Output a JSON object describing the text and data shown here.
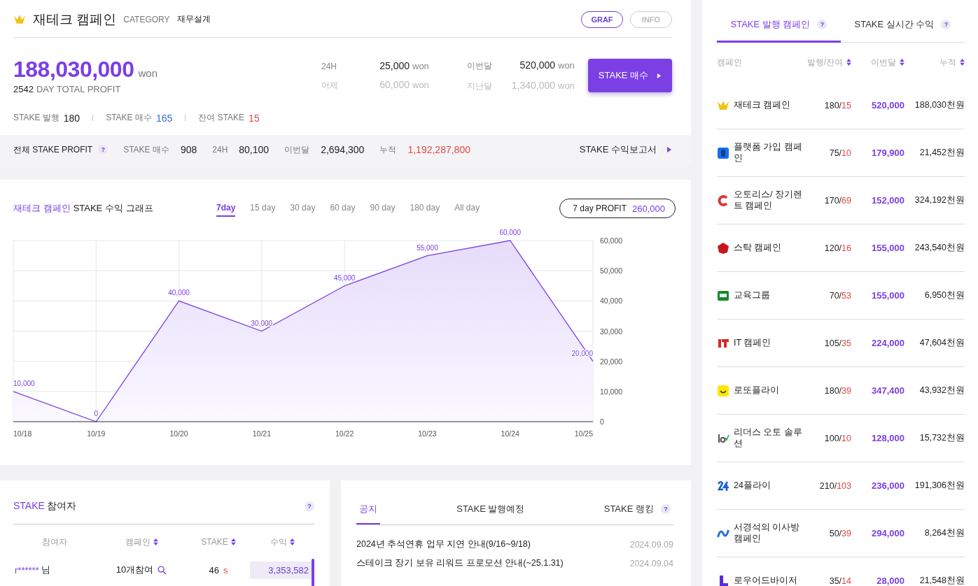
{
  "header": {
    "title": "재테크 캠페인",
    "category_label": "CATEGORY",
    "category": "재무설계",
    "buttons": [
      {
        "label": "GRAF",
        "selected": true
      },
      {
        "label": "INFO",
        "selected": false
      }
    ]
  },
  "total": {
    "amount": "188,030,000",
    "unit": "won",
    "days": "2542",
    "caption": "DAY TOTAL PROFIT"
  },
  "stats": [
    [
      {
        "label": "24H",
        "value": "25,000",
        "unit": "won",
        "muted": false
      },
      {
        "label": "어제",
        "value": "60,000",
        "unit": "won",
        "muted": true
      }
    ],
    [
      {
        "label": "이번달",
        "value": "520,000",
        "unit": "won",
        "muted": false
      },
      {
        "label": "지난달",
        "value": "1,340,000",
        "unit": "won",
        "muted": true
      }
    ]
  ],
  "buy_button": "STAKE 매수",
  "counts": [
    {
      "label": "STAKE 발행",
      "value": "180",
      "color": "#222222"
    },
    {
      "label": "STAKE 매수",
      "value": "165",
      "color": "#2f6fd0"
    },
    {
      "label": "잔여 STAKE",
      "value": "15",
      "color": "#e04848"
    }
  ],
  "profit_bar": {
    "title": "전체 STAKE PROFIT",
    "items": [
      {
        "label": "STAKE 매수",
        "value": "908",
        "color": "#222222"
      },
      {
        "label": "24H",
        "value": "80,100",
        "color": "#222222"
      },
      {
        "label": "이번달",
        "value": "2,694,300",
        "color": "#222222"
      },
      {
        "label": "누적",
        "value": "1,192,287,800",
        "color": "#e04848"
      }
    ],
    "report_link": "STAKE 수익보고서"
  },
  "graph": {
    "title_highlight": "재테크 캠페인",
    "title": "STAKE 수익 그래프",
    "ranges": [
      {
        "label": "7day",
        "selected": true
      },
      {
        "label": "15 day",
        "selected": false
      },
      {
        "label": "30 day",
        "selected": false
      },
      {
        "label": "60 day",
        "selected": false
      },
      {
        "label": "90 day",
        "selected": false
      },
      {
        "label": "180 day",
        "selected": false
      },
      {
        "label": "All day",
        "selected": false
      }
    ],
    "profit_label": "7 day PROFIT",
    "profit_value": "260,000",
    "chart_data": {
      "type": "area",
      "categories": [
        "10/18",
        "10/19",
        "10/20",
        "10/21",
        "10/22",
        "10/23",
        "10/24",
        "10/25"
      ],
      "series": [
        {
          "color": "#7b3fe4",
          "values": [
            10000,
            0,
            40000,
            30000,
            45000,
            55000,
            60000,
            20000
          ]
        }
      ],
      "value_labels": [
        "10,000",
        "0",
        "40,000",
        "30,000",
        "45,000",
        "55,000",
        "60,000",
        "20,000"
      ],
      "grid": true,
      "ylim": [
        0,
        60000
      ],
      "yticks": [
        {
          "value": 0,
          "label": "0"
        },
        {
          "value": 10000,
          "label": "10,000"
        },
        {
          "value": 20000,
          "label": "20,000"
        },
        {
          "value": 30000,
          "label": "30,000"
        },
        {
          "value": 40000,
          "label": "40,000"
        },
        {
          "value": 50000,
          "label": "50,000"
        },
        {
          "value": 60000,
          "label": "60,000"
        }
      ],
      "orientation": "vertical"
    }
  },
  "participants": {
    "title_highlight": "STAKE",
    "title": "참여자",
    "help": "?",
    "columns": [
      {
        "label": "참여자",
        "sortable": false
      },
      {
        "label": "캠페인",
        "sortable": true
      },
      {
        "label": "STAKE",
        "sortable": true
      },
      {
        "label": "수익",
        "sortable": true
      }
    ],
    "rows": [
      {
        "name": "r******",
        "suffix": "님",
        "campaign": "10개참여",
        "stake": "46",
        "stake_unit": "s",
        "profit": "3,353,582"
      }
    ]
  },
  "notices": {
    "tabs": [
      {
        "label": "공지",
        "selected": true,
        "help": false
      },
      {
        "label": "STAKE 발행예정",
        "selected": false,
        "help": false
      },
      {
        "label": "STAKE 랭킹",
        "selected": false,
        "help": true
      }
    ],
    "help": "?",
    "items": [
      {
        "title": "2024년 추석연휴 업무 지연 안내(9/16~9/18)",
        "date": "2024.09.09"
      },
      {
        "title": "스테이크 장기 보유 리워드 프로모션 안내(~25.1.31)",
        "date": "2024.09.04"
      }
    ]
  },
  "campaigns": {
    "tabs": [
      {
        "label": "STAKE 발행 캠페인",
        "selected": true
      },
      {
        "label": "STAKE 실시간 수익",
        "selected": false
      }
    ],
    "help": "?",
    "columns": [
      {
        "label": "캠페인",
        "sortable": false
      },
      {
        "label": "발행/잔여",
        "sortable": true
      },
      {
        "label": "이번달",
        "sortable": true
      },
      {
        "label": "누적",
        "sortable": true
      }
    ],
    "rows": [
      {
        "kind": "w",
        "name": "재테크 캠페인",
        "issued": "180/",
        "remaining": "15",
        "month": "520,000",
        "total": "188,030천원"
      },
      {
        "kind": "p",
        "name": "플랫폼 가입 캠페인",
        "issued": "75/",
        "remaining": "10",
        "month": "179,900",
        "total": "21,452천원"
      },
      {
        "kind": "c",
        "name": "오토리스/ 장기렌트 캠페인",
        "issued": "170/",
        "remaining": "69",
        "month": "152,000",
        "total": "324,192천원"
      },
      {
        "kind": "s",
        "name": "스탁 캠페인",
        "issued": "120/",
        "remaining": "16",
        "month": "155,000",
        "total": "243,540천원"
      },
      {
        "kind": "edu",
        "name": "교육그룹",
        "issued": "70/",
        "remaining": "53",
        "month": "155,000",
        "total": "6,950천원"
      },
      {
        "kind": "it",
        "name": "IT 캠페인",
        "issued": "105/",
        "remaining": "35",
        "month": "224,000",
        "total": "47,604천원"
      },
      {
        "kind": "smile",
        "name": "로또플라이",
        "issued": "180/",
        "remaining": "39",
        "month": "347,400",
        "total": "43,932천원"
      },
      {
        "kind": "las",
        "name": "리더스 오토 솔루션",
        "issued": "100/",
        "remaining": "10",
        "month": "128,000",
        "total": "15,732천원"
      },
      {
        "kind": "n24",
        "name": "24플라이",
        "issued": "210/",
        "remaining": "103",
        "month": "236,000",
        "total": "191,306천원"
      },
      {
        "kind": "wave",
        "name": "서경석의 이사방 캠페인",
        "issued": "50/",
        "remaining": "39",
        "month": "294,000",
        "total": "8,264천원"
      },
      {
        "kind": "l",
        "name": "로우어드바이저",
        "issued": "35/",
        "remaining": "14",
        "month": "28,000",
        "total": "21,548천원"
      }
    ]
  }
}
